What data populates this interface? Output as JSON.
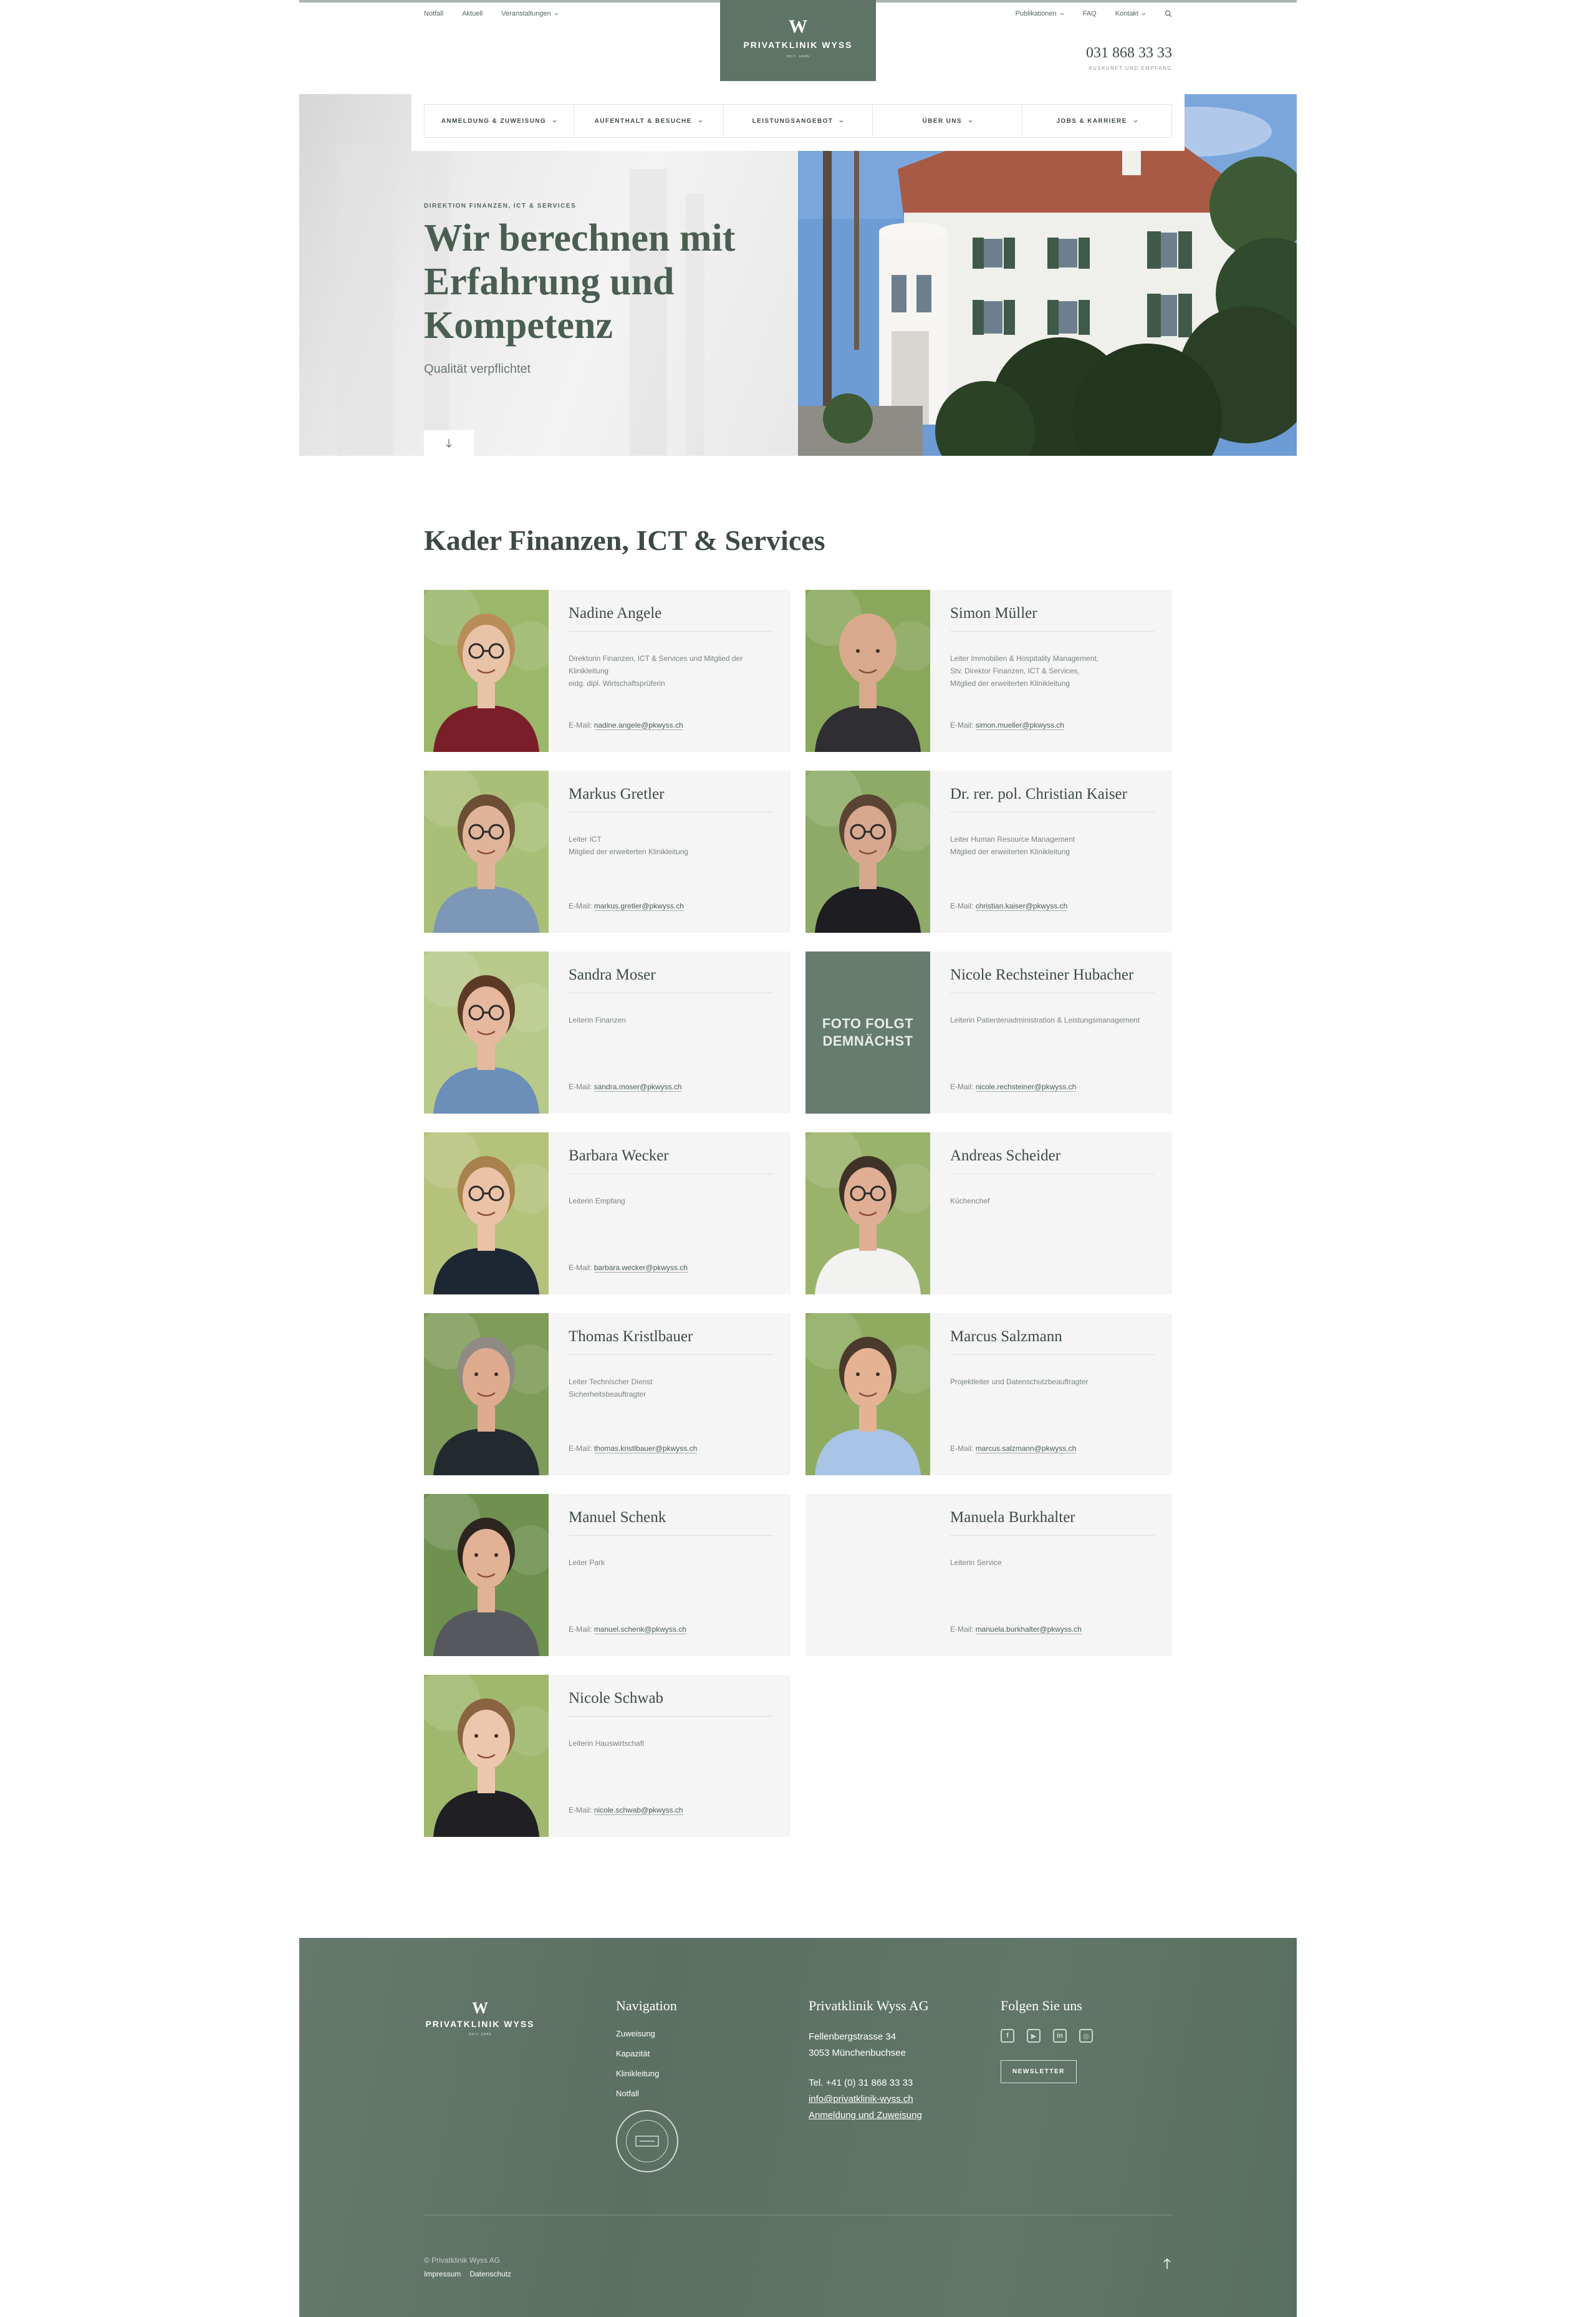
{
  "header": {
    "util_left": [
      "Notfall",
      "Aktuell",
      "Veranstaltungen"
    ],
    "util_right": [
      "Publikationen",
      "FAQ",
      "Kontakt"
    ],
    "logo_mark": "W",
    "logo_name": "PRIVATKLINIK WYSS",
    "logo_since": "SEIT 1845",
    "phone": "031 868 33 33",
    "phone_caption": "AUSKUNFT UND EMPFANG"
  },
  "nav": {
    "items": [
      "ANMELDUNG & ZUWEISUNG",
      "AUFENTHALT & BESUCHE",
      "LEISTUNGSANGEBOT",
      "ÜBER UNS",
      "JOBS & KARRIERE"
    ]
  },
  "hero": {
    "kicker": "DIREKTION FINANZEN, ICT & SERVICES",
    "title": "Wir berechnen mit Erfahrung und Kompetenz",
    "subtitle": "Qualität verpflichtet"
  },
  "team": {
    "title": "Kader Finanzen, ICT & Services",
    "email_prefix": "E-Mail:",
    "placeholder_text": "FOTO FOLGT DEMNÄCHST",
    "members": [
      {
        "name": "Nadine Angele",
        "role": "Direktorin Finanzen, ICT & Services und Mitglied der Klinikleitung\neidg. dipl. Wirtschaftsprüferin",
        "email": "nadine.angele@pkwyss.ch",
        "photo": "woman-glasses-blonde"
      },
      {
        "name": "Simon Müller",
        "role": "Leiter Immobilien & Hospitality Management,\nStv. Direktor Finanzen, ICT & Services,\nMitglied der erweiterten Klinikleitung",
        "email": "simon.mueller@pkwyss.ch",
        "photo": "man-bald"
      },
      {
        "name": "Markus Gretler",
        "role": "Leiter ICT\nMitglied der erweiterten Klinikleitung",
        "email": "markus.gretler@pkwyss.ch",
        "photo": "man-glasses"
      },
      {
        "name": "Dr. rer. pol. Christian Kaiser",
        "role": "Leiter Human Resource Management\nMitglied der erweiterten Klinikleitung",
        "email": "christian.kaiser@pkwyss.ch",
        "photo": "man-beard-glasses"
      },
      {
        "name": "Sandra Moser",
        "role": "Leiterin Finanzen",
        "email": "sandra.moser@pkwyss.ch",
        "photo": "woman-glasses-brown"
      },
      {
        "name": "Nicole Rechsteiner Hubacher",
        "role": "Leiterin Patientenadministration & Leistungsmanagement",
        "email": "nicole.rechsteiner@pkwyss.ch",
        "photo": "placeholder"
      },
      {
        "name": "Barbara Wecker",
        "role": "Leiterin Empfang",
        "email": "barbara.wecker@pkwyss.ch",
        "photo": "woman-curly"
      },
      {
        "name": "Andreas Scheider",
        "role": "Küchenchef",
        "email": "",
        "photo": "man-chef"
      },
      {
        "name": "Thomas Kristlbauer",
        "role": "Leiter Technischer Dienst\nSicherheitsbeauftragter",
        "email": "thomas.kristlbauer@pkwyss.ch",
        "photo": "man-grey"
      },
      {
        "name": "Marcus Salzmann",
        "role": "Projektleiter und Datenschutzbeauftragter",
        "email": "marcus.salzmann@pkwyss.ch",
        "photo": "man-blue-shirt"
      },
      {
        "name": "Manuel Schenk",
        "role": "Leiter Park",
        "email": "manuel.schenk@pkwyss.ch",
        "photo": "man-dark-hair"
      },
      {
        "name": "Manuela Burkhalter",
        "role": "Leiterin Service",
        "email": "manuela.burkhalter@pkwyss.ch",
        "photo": "none"
      },
      {
        "name": "Nicole Schwab",
        "role": "Leiterin Hauswirtschaft",
        "email": "nicole.schwab@pkwyss.ch",
        "photo": "woman-young"
      }
    ]
  },
  "footer": {
    "logo_mark": "W",
    "logo_name": "PRIVATKLINIK WYSS",
    "logo_since": "SEIT 1845",
    "nav_title": "Navigation",
    "nav_links": [
      "Zuweisung",
      "Kapazität",
      "Klinikleitung",
      "Notfall"
    ],
    "company": "Privatklinik Wyss AG",
    "street": "Fellenbergstrasse 34",
    "city": "3053 Münchenbuchsee",
    "tel": "Tel. +41 (0) 31 868 33 33",
    "email": "info@privatklinik-wyss.ch",
    "referral_link": "Anmeldung und Zuweisung",
    "follow_title": "Folgen Sie uns",
    "socials": [
      "facebook-icon",
      "youtube-icon",
      "linkedin-icon",
      "instagram-icon"
    ],
    "newsletter": "NEWSLETTER",
    "copyright": "© Privatklinik Wyss AG",
    "legal": [
      "Impressum",
      "Datenschutz"
    ],
    "colors": {
      "footer_bg": "#5e7466",
      "accent": "#5e7466"
    }
  }
}
